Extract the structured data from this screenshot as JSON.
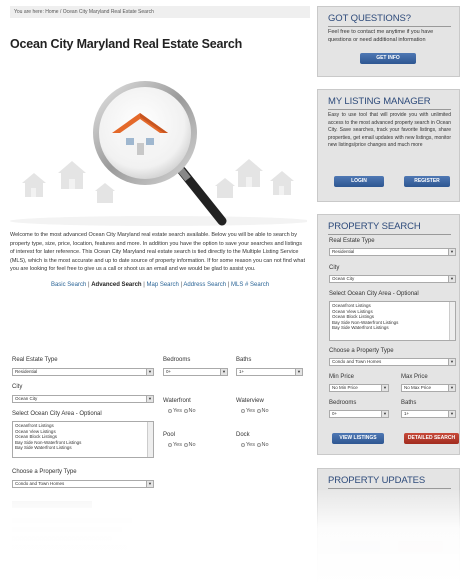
{
  "breadcrumb": {
    "prefix": "You are here:",
    "home": "Home",
    "sep": " / ",
    "current": "Ocean City Maryland Real Estate Search"
  },
  "page_title": "Ocean City Maryland Real Estate Search",
  "intro": "Welcome to the most advanced Ocean City Maryland real estate search available.  Below you will be able to search by property type, size, price, location, features and more.  In addition you have the option to save your searches and listings of interest for later reference.  This Ocean City Maryland real estate search is tied directly to the Multiple Listing Service (MLS), which is the most accurate and up to date source of property information.  If for some reason you can not find what you are looking for feel free to give us a call or shoot us an email and we would be glad to assist you.",
  "search_links": {
    "basic": "Basic Search",
    "advanced": "Advanced Search",
    "map": "Map Search",
    "address": "Address Search",
    "mls": "MLS # Search",
    "sep": " | "
  },
  "form": {
    "real_estate_type_label": "Real Estate Type",
    "real_estate_type": "Residential",
    "bedrooms_label": "Bedrooms",
    "bedrooms": "0+",
    "baths_label": "Baths",
    "baths": "1+",
    "city_label": "City",
    "city": "Ocean City",
    "waterfront_label": "Waterfront",
    "waterview_label": "Waterview",
    "area_label": "Select Ocean City Area - Optional",
    "areas": [
      "Oceanfront Listings",
      "Ocean View Listings",
      "Ocean Block Listings",
      "Bay Side Non-Waterfront Listings",
      "Bay Side Waterfront Listings"
    ],
    "pool_label": "Pool",
    "dock_label": "Dock",
    "yes": "Yes",
    "no": "No",
    "property_type_label": "Choose a Property Type",
    "property_type": "Condo and Town Homes"
  },
  "questions": {
    "title": "GOT QUESTIONS?",
    "text": "Feel free to contact me anytime if you have questions or need additional information",
    "button": "GET INFO"
  },
  "listing_manager": {
    "title": "MY LISTING MANAGER",
    "text": "Easy to use tool that will provide you with unlimited access to the most advanced property search in Ocean City. Save searches, track your favorite listings, share properties, get email updates with new listings, monitor new listings/price changes and much more",
    "login": "LOGIN",
    "register": "REGISTER"
  },
  "property_search": {
    "title": "PROPERTY SEARCH",
    "type_label": "Real Estate Type",
    "type": "Residential",
    "city_label": "City",
    "city": "Ocean City",
    "area_label": "Select Ocean City Area - Optional",
    "areas": [
      "Oceanfront Listings",
      "Ocean View Listings",
      "Ocean Block Listings",
      "Bay Side Non-Waterfront Listings",
      "Bay Side Waterfront Listings"
    ],
    "ptype_label": "Choose a Property Type",
    "ptype": "Condo and Town Homes",
    "min_label": "Min Price",
    "min": "No Min Price",
    "max_label": "Max Price",
    "max": "No Max Price",
    "bed_label": "Bedrooms",
    "bed": "0+",
    "bath_label": "Baths",
    "bath": "1+",
    "view_btn": "VIEW LISTINGS",
    "detailed_btn": "DETAILED SEARCH"
  },
  "updates": {
    "title": "PROPERTY UPDATES"
  },
  "colors": {
    "heading_blue": "#2d4a7a",
    "button_blue": "#3a64a3",
    "button_red": "#b43a2c",
    "sidebar_bg": "#e4e4e4"
  }
}
